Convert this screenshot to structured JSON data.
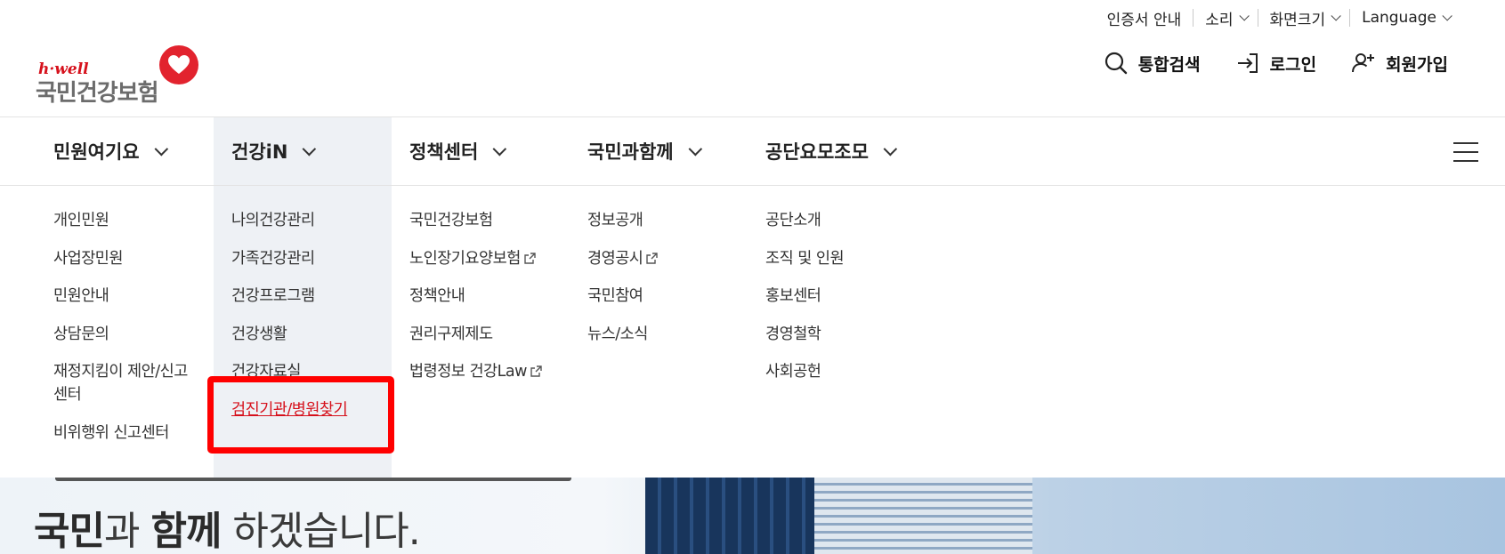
{
  "utility": {
    "items": [
      {
        "label": "인증서 안내",
        "has_chevron": false
      },
      {
        "label": "소리",
        "has_chevron": true
      },
      {
        "label": "화면크기",
        "has_chevron": true
      },
      {
        "label": "Language",
        "has_chevron": true
      }
    ]
  },
  "logo": {
    "tagline": "h·well",
    "name": "국민건강보험",
    "brand_color": "#d6111c",
    "icon": "heart-logo-icon"
  },
  "actions": {
    "search": {
      "label": "통합검색",
      "icon": "search-icon"
    },
    "login": {
      "label": "로그인",
      "icon": "login-icon"
    },
    "signup": {
      "label": "회원가입",
      "icon": "user-plus-icon"
    }
  },
  "gnb": {
    "menus": [
      {
        "label": "민원여기요"
      },
      {
        "label": "건강iN",
        "active": true
      },
      {
        "label": "정책센터"
      },
      {
        "label": "국민과함께"
      },
      {
        "label": "공단요모조모"
      }
    ],
    "hamburger_icon": "hamburger-menu-icon"
  },
  "dropdown": {
    "columns": [
      {
        "items": [
          "개인민원",
          "사업장민원",
          "민원안내",
          "상담문의",
          "재정지킴이 제안/신고센터",
          "비위행위 신고센터"
        ]
      },
      {
        "items": [
          "나의건강관리",
          "가족건강관리",
          "건강프로그램",
          "건강생활",
          "건강자료실",
          "검진기관/병원찾기"
        ]
      },
      {
        "items": [
          "국민건강보험",
          "노인장기요양보험",
          "정책안내",
          "권리구제제도",
          "법령정보 건강Law"
        ]
      },
      {
        "items": [
          "정보공개",
          "경영공시",
          "국민참여",
          "뉴스/소식"
        ]
      },
      {
        "items": [
          "공단소개",
          "조직 및 인원",
          "홍보센터",
          "경영철학",
          "사회공헌"
        ]
      }
    ],
    "external_link_icon": "external-link-icon"
  },
  "hero": {
    "strong1": "국민",
    "text1": "과 ",
    "strong2": "함께",
    "text2": " 하겠습니다."
  },
  "colors": {
    "highlight_bg": "#eef1f5",
    "highlight_box": "#ff0000",
    "active_link": "#d6111c"
  }
}
